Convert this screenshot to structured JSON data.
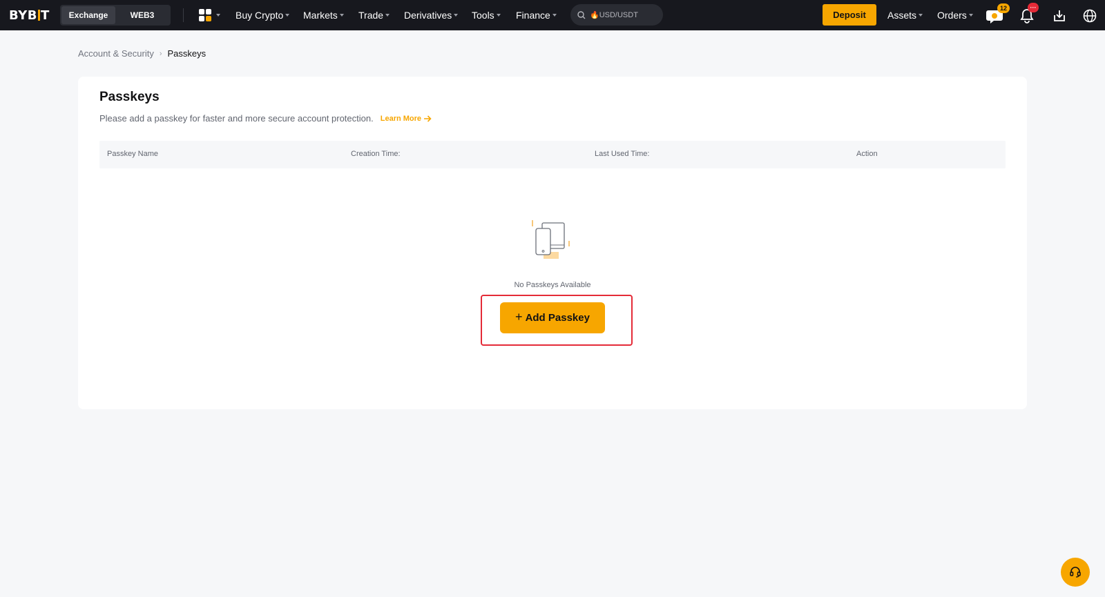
{
  "header": {
    "logo_text": "BYBIT",
    "segments": [
      "Exchange",
      "WEB3"
    ],
    "nav": [
      "Buy Crypto",
      "Markets",
      "Trade",
      "Derivatives",
      "Tools",
      "Finance"
    ],
    "search_placeholder": "🔥USD/USDT",
    "deposit_label": "Deposit",
    "right_nav": [
      "Assets",
      "Orders"
    ],
    "chat_badge": "12",
    "notification_badge": "···"
  },
  "breadcrumb": {
    "parent": "Account & Security",
    "current": "Passkeys"
  },
  "card": {
    "title": "Passkeys",
    "description": "Please add a passkey for faster and more secure account protection.",
    "learn_more": "Learn More",
    "columns": [
      "Passkey Name",
      "Creation Time:",
      "Last Used Time:",
      "Action"
    ],
    "empty_text": "No Passkeys Available",
    "add_button": "Add Passkey",
    "add_button_prefix": "+"
  },
  "colors": {
    "brand": "#f7a600",
    "nav_bg": "#17181e",
    "highlight": "#e42a37"
  }
}
